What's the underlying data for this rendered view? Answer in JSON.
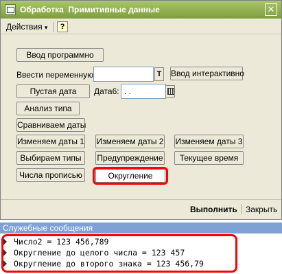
{
  "window": {
    "title": "Обработка  Примитивные данные",
    "close_glyph": "✕"
  },
  "menu": {
    "actions_label": "Действия",
    "actions_arrow": "▾",
    "help_label": "?"
  },
  "form": {
    "btn_input_programmatic": "Ввод программно",
    "label_enter_variable": "Ввести переменную:",
    "t_button": "T",
    "btn_input_interactive": "Ввод интерактивно",
    "btn_empty_date": "Пустая дата",
    "label_date6": "Дата6:",
    "date6_value": " .  .",
    "btn_type_analysis": "Анализ типа",
    "btn_compare_dates": "Сравниваем даты",
    "btn_change_dates_1": "Изменяем даты 1",
    "btn_change_dates_2": "Изменяем даты 2",
    "btn_change_dates_3": "Изменяем даты 3",
    "btn_choose_types": "Выбираем типы",
    "btn_warning": "Предупреждение",
    "btn_current_time": "Текущее время",
    "btn_numbers_in_words": "Числа прописью",
    "btn_rounding": "Округление"
  },
  "footer": {
    "run_label": "Выполнить",
    "close_label": "Закрыть"
  },
  "messages": {
    "header": "Служебные сообщения",
    "lines": [
      "Число2 = 123 456,789",
      "Округление до целого числа = 123 457",
      "Округление до второго знака = 123 456,79"
    ]
  }
}
